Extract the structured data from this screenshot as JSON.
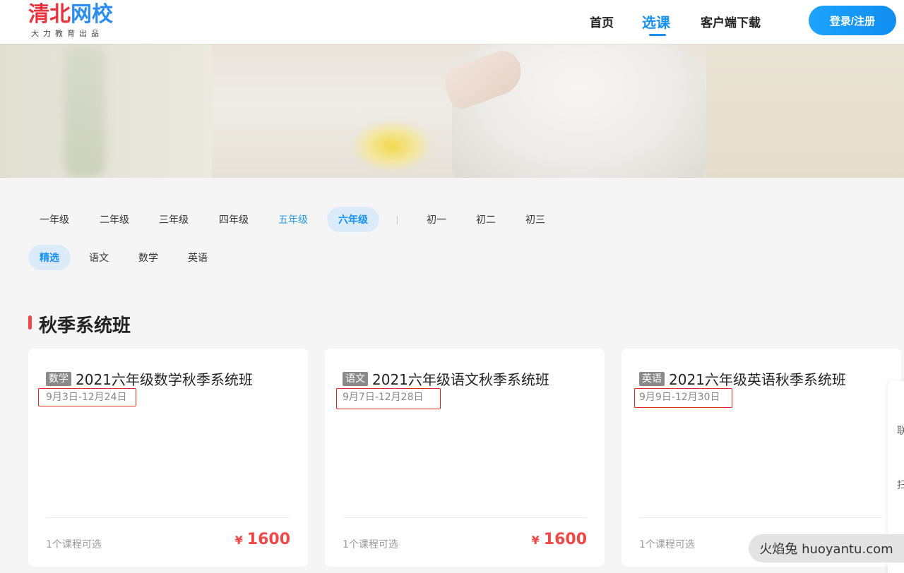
{
  "header": {
    "logo": {
      "main_red": "清北",
      "main_blue": "网校",
      "sub": "大力教育出品"
    },
    "nav": [
      {
        "label": "首页"
      },
      {
        "label": "选课"
      },
      {
        "label": "客户端下载"
      }
    ],
    "login_label": "登录/注册"
  },
  "grades": [
    "一年级",
    "二年级",
    "三年级",
    "四年级",
    "五年级",
    "六年级",
    "初一",
    "初二",
    "初三"
  ],
  "subjects": [
    "精选",
    "语文",
    "数学",
    "英语"
  ],
  "section": {
    "title": "秋季系统班"
  },
  "cards": [
    {
      "tag": "数学",
      "title": "2021六年级数学秋季系统班",
      "date": "9月3日-12月24日",
      "count": "1个课程可选",
      "price": "1600",
      "currency": "¥"
    },
    {
      "tag": "语文",
      "title": "2021六年级语文秋季系统班",
      "date": "9月7日-12月28日",
      "count": "1个课程可选",
      "price": "1600",
      "currency": "¥"
    },
    {
      "tag": "英语",
      "title": "2021六年级英语秋季系统班",
      "date": "9月9日-12月30日",
      "count": "1个课程可选"
    }
  ],
  "side_panel": {
    "item1": "联",
    "item2": "扫"
  },
  "watermark": "火焰兔 huoyantu.com",
  "colors": {
    "accent": "#1890f0",
    "price": "#f04747",
    "highlight_box": "#e22626"
  }
}
